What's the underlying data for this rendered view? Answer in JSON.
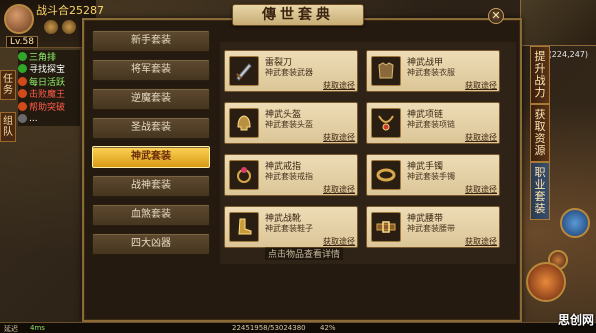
{
  "hud": {
    "player_name": "战斗合25287",
    "level": "Lv.58"
  },
  "quest_tabs": {
    "task_tab": "任务",
    "team_tab": "组队"
  },
  "quests": [
    {
      "label": "三角排",
      "color": "#8ff06a",
      "dot": "#2fa82a"
    },
    {
      "label": "寻找探宝",
      "color": "#ffffff",
      "dot": "#2fa82a"
    },
    {
      "label": "每日活跃",
      "color": "#8ff06a",
      "dot": "#d24a1a"
    },
    {
      "label": "击败魔王",
      "color": "#ff5a4a",
      "dot": "#d24a1a"
    },
    {
      "label": "帮助突破",
      "color": "#ff5a4a",
      "dot": "#d24a1a"
    },
    {
      "label": "...",
      "color": "#ffffff",
      "dot": "#6a6a6a"
    }
  ],
  "coords_text": "(224,247)",
  "panel": {
    "title": "傳世套典",
    "close_glyph": "✕"
  },
  "right_tabs": [
    {
      "label": "提升战力",
      "active": false
    },
    {
      "label": "获取资源",
      "active": false
    },
    {
      "label": "职业套装",
      "active": true
    }
  ],
  "sets": [
    {
      "label": "新手套装",
      "active": false
    },
    {
      "label": "将军套装",
      "active": false
    },
    {
      "label": "逆魔套装",
      "active": false
    },
    {
      "label": "圣战套装",
      "active": false
    },
    {
      "label": "神武套装",
      "active": true
    },
    {
      "label": "战神套装",
      "active": false
    },
    {
      "label": "血煞套装",
      "active": false
    },
    {
      "label": "四大凶器",
      "active": false
    }
  ],
  "items": [
    {
      "name": "雷裂刀",
      "desc": "神武套装武器",
      "link": "获取途径",
      "icon": "sword-icon"
    },
    {
      "name": "神武战甲",
      "desc": "神武套装衣服",
      "link": "获取途径",
      "icon": "armor-icon"
    },
    {
      "name": "神武头盔",
      "desc": "神武套装头盔",
      "link": "获取途径",
      "icon": "helmet-icon"
    },
    {
      "name": "神武项链",
      "desc": "神武套装项链",
      "link": "获取途径",
      "icon": "necklace-icon"
    },
    {
      "name": "神武戒指",
      "desc": "神武套装戒指",
      "link": "获取途径",
      "icon": "ring-icon"
    },
    {
      "name": "神武手镯",
      "desc": "神武套装手镯",
      "link": "获取途径",
      "icon": "bracelet-icon"
    },
    {
      "name": "神武战靴",
      "desc": "神武套装鞋子",
      "link": "获取途径",
      "icon": "boots-icon"
    },
    {
      "name": "神武腰带",
      "desc": "神武套装腰带",
      "link": "获取途径",
      "icon": "belt-icon"
    }
  ],
  "hint": "点击物品查看详情",
  "bottom": {
    "ping_label": "延迟",
    "ping_value": "4ms",
    "exp_text": "22451958/53024380",
    "percent_text": "42%"
  },
  "watermark": "思创网"
}
